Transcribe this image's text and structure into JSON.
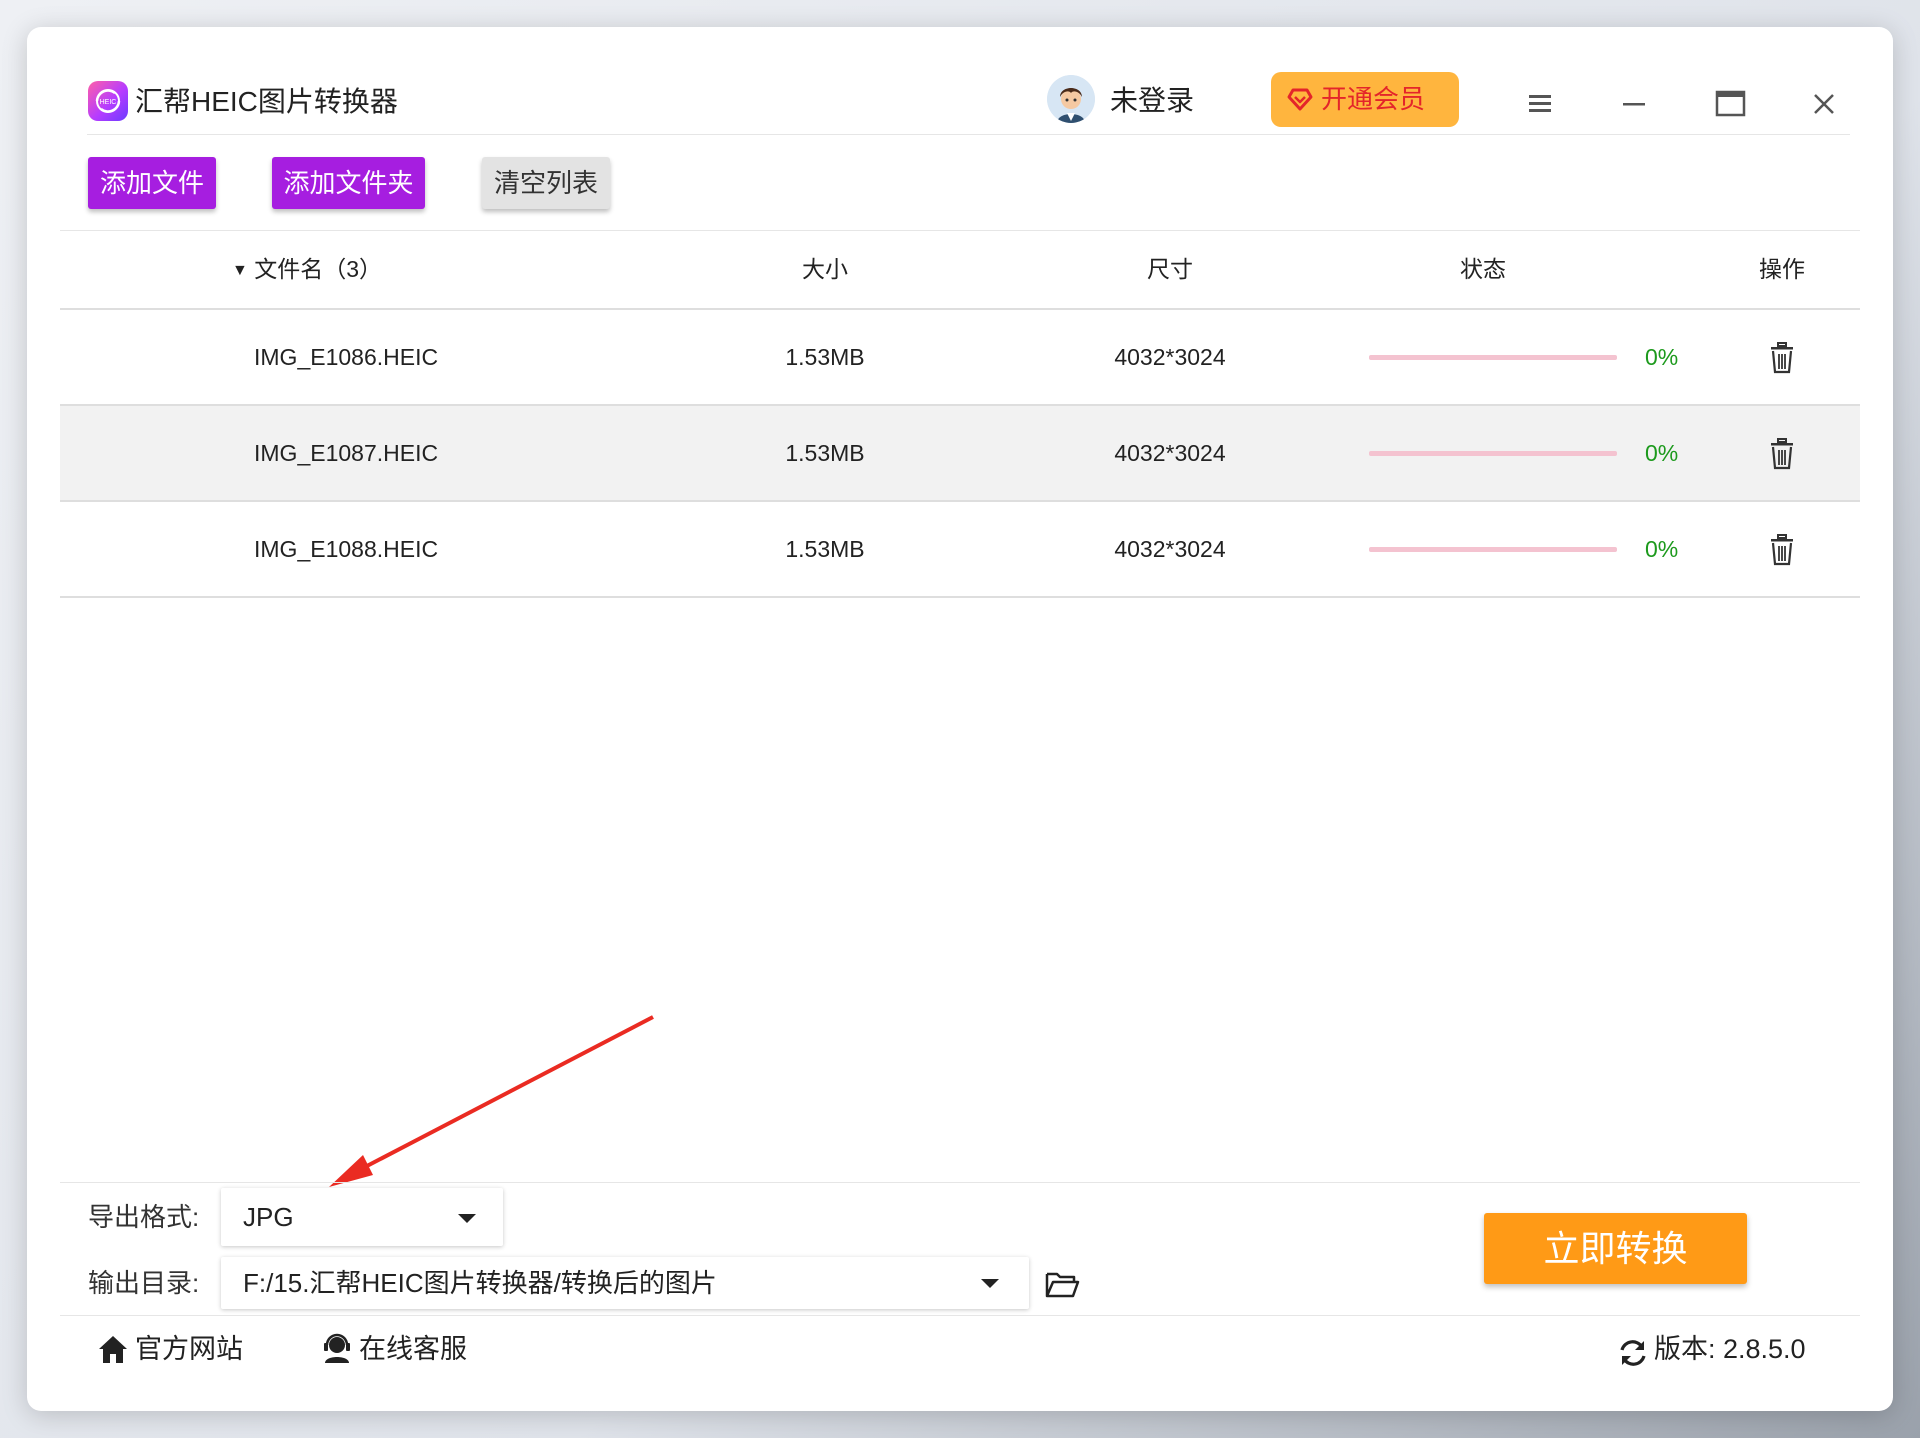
{
  "app": {
    "title": "汇帮HEIC图片转换器",
    "user_status": "未登录",
    "vip_label": "开通会员",
    "accent_purple": "#a61ee0",
    "accent_orange": "#ff9a16"
  },
  "toolbar": {
    "add_file": "添加文件",
    "add_folder": "添加文件夹",
    "clear_list": "清空列表"
  },
  "table": {
    "headers": {
      "name": "文件名（3）",
      "size": "大小",
      "dimension": "尺寸",
      "status": "状态",
      "action": "操作"
    },
    "rows": [
      {
        "name": "IMG_E1086.HEIC",
        "size": "1.53MB",
        "dimension": "4032*3024",
        "progress": 0,
        "progress_text": "0%"
      },
      {
        "name": "IMG_E1087.HEIC",
        "size": "1.53MB",
        "dimension": "4032*3024",
        "progress": 0,
        "progress_text": "0%"
      },
      {
        "name": "IMG_E1088.HEIC",
        "size": "1.53MB",
        "dimension": "4032*3024",
        "progress": 0,
        "progress_text": "0%"
      }
    ]
  },
  "settings": {
    "format_label": "导出格式:",
    "format_value": "JPG",
    "output_label": "输出目录:",
    "output_value": "F:/15.汇帮HEIC图片转换器/转换后的图片"
  },
  "convert_button": "立即转换",
  "footer": {
    "website": "官方网站",
    "support": "在线客服",
    "version": "版本: 2.8.5.0"
  }
}
